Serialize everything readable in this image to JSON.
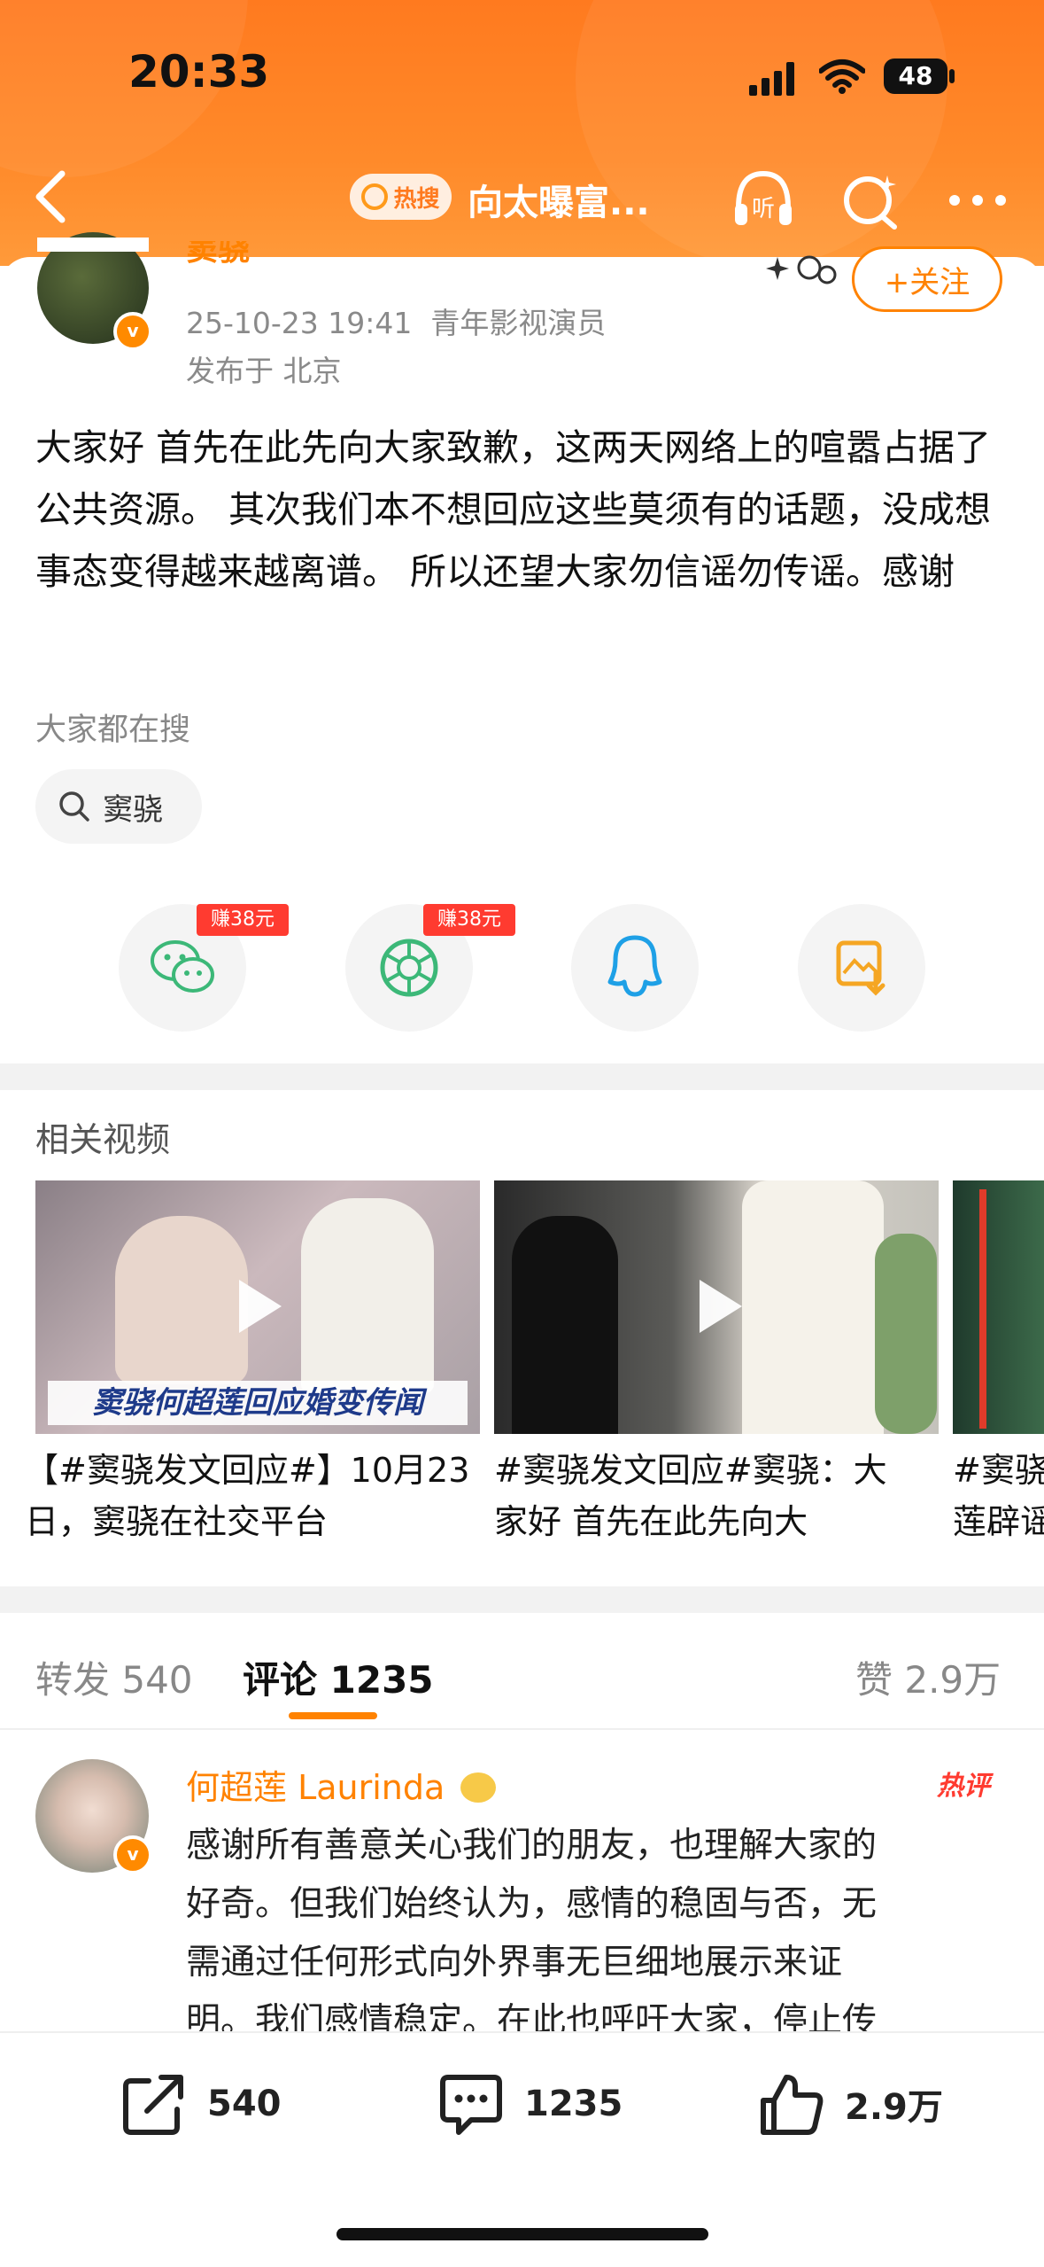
{
  "status_bar": {
    "time": "20:33",
    "battery": "48"
  },
  "nav": {
    "hot_tag": "热搜",
    "title": "向太曝富..."
  },
  "post": {
    "author": "窦骁",
    "meta_line": "25-10-23 19:41  青年影视演员",
    "location": "发布于 北京",
    "follow_label": "+关注",
    "text": "大家好 首先在此先向大家致歉，这两天网络上的喧嚣占据了公共资源。 其次我们本不想回应这些莫须有的话题，没成想事态变得越来越离谱。 所以还望大家勿信谣勿传谣。感谢"
  },
  "search_section": {
    "label": "大家都在搜",
    "chip": "窦骁"
  },
  "share": {
    "items": [
      {
        "icon": "wechat-icon",
        "earn": "赚38元"
      },
      {
        "icon": "moments-icon",
        "earn": "赚38元"
      },
      {
        "icon": "qq-icon",
        "earn": ""
      },
      {
        "icon": "save-image-icon",
        "earn": ""
      }
    ]
  },
  "videos": {
    "heading": "相关视频",
    "items": [
      {
        "overlay": "窦骁何超莲回应婚变传闻",
        "caption_l1": "【#窦骁发文回应#】10月23",
        "caption_l2": "日，窦骁在社交平台"
      },
      {
        "overlay": "",
        "caption_l1": "#窦骁发文回应#窦骁：大",
        "caption_l2": "家好 首先在此先向大"
      },
      {
        "overlay": "",
        "caption_l1": "#窦骁",
        "caption_l2": "莲辟谣"
      }
    ]
  },
  "tabs": {
    "repost": "转发 540",
    "comment": "评论 1235",
    "like": "赞 2.9万"
  },
  "comment": {
    "author": "何超莲 Laurinda",
    "hot_badge": "热评",
    "text_l1": "感谢所有善意关心我们的朋友，也理解大家的",
    "text_l2": "好奇。但我们始终认为，感情的稳固与否，无",
    "text_l3": "需通过任何形式向外界事无巨细地展示来证",
    "text_l4": "明。我们感情稳定。在此也呼吁大家，停止传"
  },
  "bottom_bar": {
    "repost": "540",
    "comment": "1235",
    "like": "2.9万"
  },
  "colors": {
    "accent": "#ff8200",
    "header": "#ff7a1f"
  }
}
